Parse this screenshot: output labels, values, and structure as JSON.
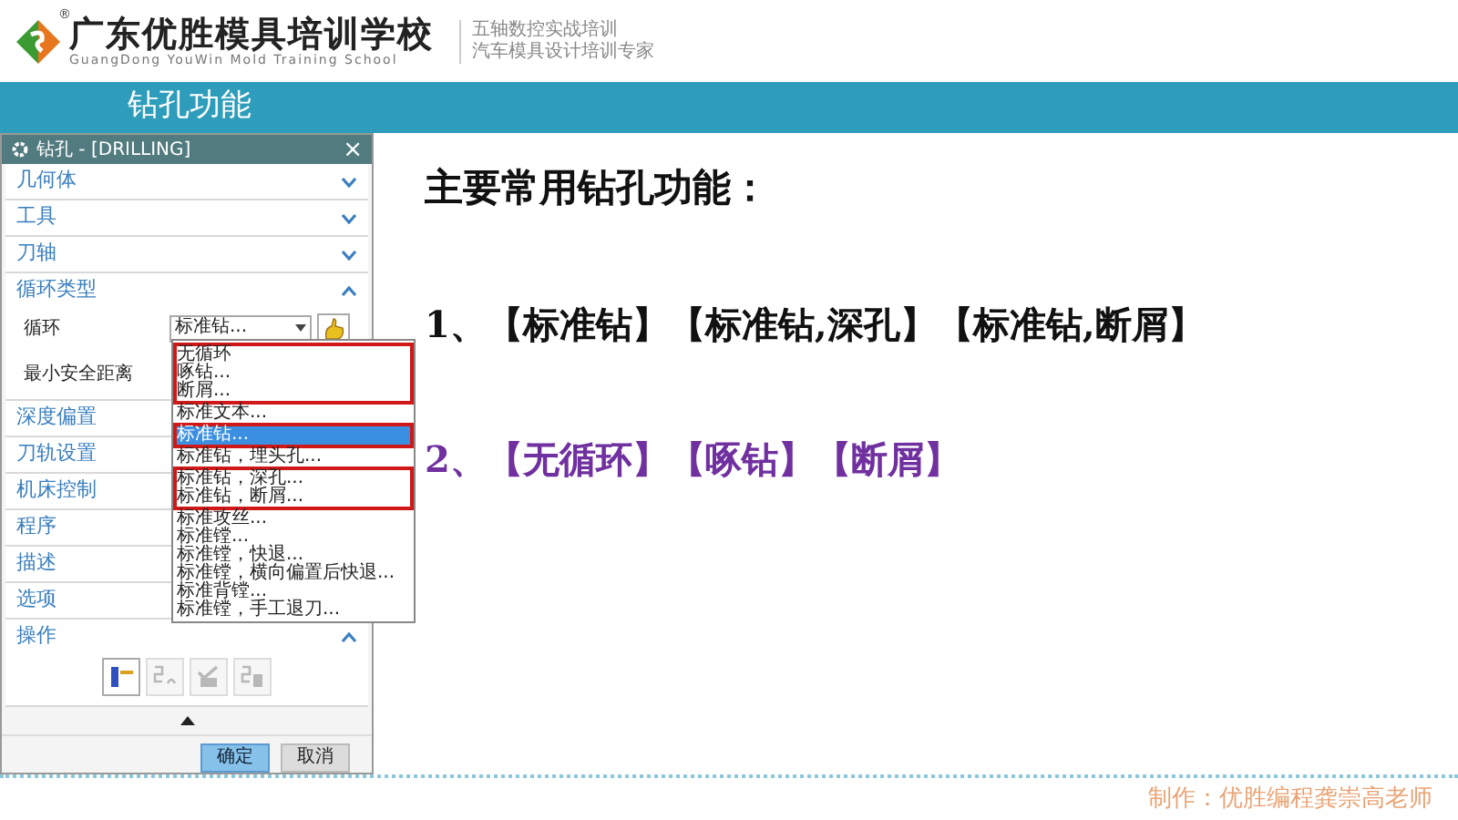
{
  "header": {
    "registered_mark": "®",
    "school_name": "广东优胜模具培训学校",
    "school_name_en": "GuangDong YouWin Mold Training School",
    "taglines": [
      "五轴数控实战培训",
      "汽车模具设计培训专家"
    ]
  },
  "slide_title": "钻孔功能",
  "dialog": {
    "title": "钻孔 - [DRILLING]",
    "close": "×",
    "sections": [
      {
        "label": "几何体",
        "expanded": false
      },
      {
        "label": "工具",
        "expanded": false
      },
      {
        "label": "刀轴",
        "expanded": false
      },
      {
        "label": "循环类型",
        "kind": "cycle",
        "expanded": true,
        "fields": [
          {
            "label": "循环",
            "value": "标准钻..."
          },
          {
            "label": "最小安全距离"
          }
        ]
      },
      {
        "label": "深度偏置"
      },
      {
        "label": "刀轨设置"
      },
      {
        "label": "机床控制"
      },
      {
        "label": "程序"
      },
      {
        "label": "描述"
      },
      {
        "label": "选项"
      },
      {
        "label": "操作",
        "kind": "actions",
        "expanded": true,
        "icons": [
          {
            "disabled": false
          },
          {
            "disabled": true
          },
          {
            "disabled": true
          },
          {
            "disabled": true
          }
        ]
      }
    ],
    "buttons": [
      {
        "label": "确定",
        "kind": "primary"
      },
      {
        "label": "取消",
        "kind": "secondary"
      }
    ],
    "dropdown": [
      {
        "label": "无循环",
        "selected": false,
        "boxed": true
      },
      {
        "label": "啄钻...",
        "selected": false,
        "boxed": true
      },
      {
        "label": "断屑...",
        "selected": false,
        "boxed": true
      },
      {
        "label": "标准文本...",
        "selected": false,
        "boxed": false
      },
      {
        "label": "标准钻...",
        "selected": true,
        "boxed": true
      },
      {
        "label": "标准钻，埋头孔...",
        "selected": false,
        "boxed": false
      },
      {
        "label": "标准钻，深孔...",
        "selected": false,
        "boxed": true
      },
      {
        "label": "标准钻，断屑...",
        "selected": false,
        "boxed": true
      },
      {
        "label": "标准攻丝...",
        "selected": false,
        "boxed": false
      },
      {
        "label": "标准镗...",
        "selected": false,
        "boxed": false
      },
      {
        "label": "标准镗，快退...",
        "selected": false,
        "boxed": false
      },
      {
        "label": "标准镗，横向偏置后快退...",
        "selected": false,
        "boxed": false
      },
      {
        "label": "标准背镗...",
        "selected": false,
        "boxed": false
      },
      {
        "label": "标准镗，手工退刀...",
        "selected": false,
        "boxed": false
      }
    ]
  },
  "content": {
    "heading": "主要常用钻孔功能：",
    "lines": [
      {
        "text": "1、【标准钻】【标准钻,深孔】【标准钻,断屑】",
        "color": "#111111"
      },
      {
        "text": "2、【无循环】【啄钻】【断屑】",
        "color": "#7030a0"
      }
    ]
  },
  "footer": "制作：优胜编程龚崇高老师"
}
